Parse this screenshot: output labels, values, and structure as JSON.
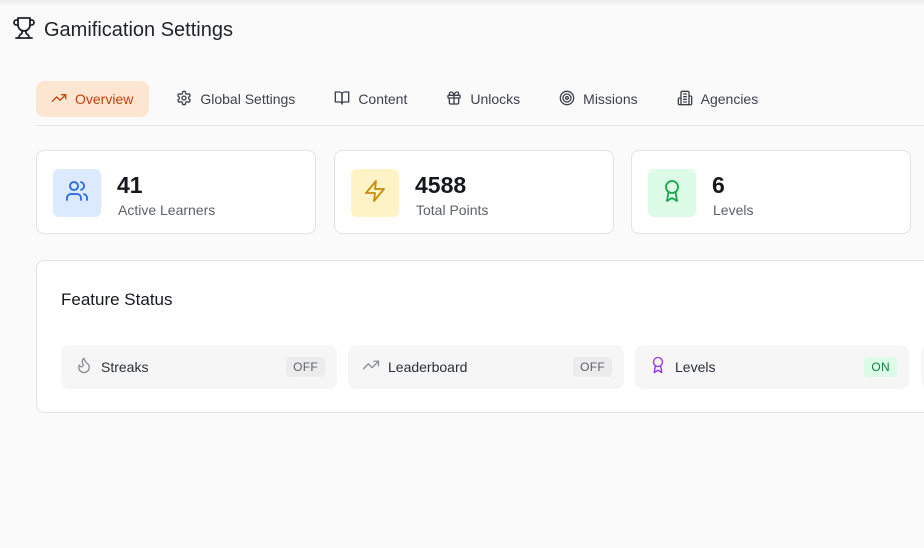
{
  "header": {
    "title": "Gamification Settings",
    "icon": "trophy-icon"
  },
  "tabs": [
    {
      "label": "Overview",
      "icon": "trending-up-icon",
      "active": true
    },
    {
      "label": "Global Settings",
      "icon": "gear-icon",
      "active": false
    },
    {
      "label": "Content",
      "icon": "book-icon",
      "active": false
    },
    {
      "label": "Unlocks",
      "icon": "gift-icon",
      "active": false
    },
    {
      "label": "Missions",
      "icon": "target-icon",
      "active": false
    },
    {
      "label": "Agencies",
      "icon": "building-icon",
      "active": false
    }
  ],
  "stats": [
    {
      "value": "41",
      "label": "Active Learners",
      "icon": "users-icon",
      "color": "#2563eb",
      "bg": "#dbeafe"
    },
    {
      "value": "4588",
      "label": "Total Points",
      "icon": "lightning-icon",
      "color": "#ca8a04",
      "bg": "#fef3c7"
    },
    {
      "value": "6",
      "label": "Levels",
      "icon": "award-icon",
      "color": "#16a34a",
      "bg": "#dcfce7"
    }
  ],
  "feature_status": {
    "title": "Feature Status",
    "items": [
      {
        "label": "Streaks",
        "status": "OFF",
        "icon": "flame-icon",
        "color": "#8a8f98"
      },
      {
        "label": "Leaderboard",
        "status": "OFF",
        "icon": "trending-up-icon",
        "color": "#8a8f98"
      },
      {
        "label": "Levels",
        "status": "ON",
        "icon": "award-icon",
        "color": "#9333ea"
      }
    ]
  },
  "colors": {
    "accent": "#c2410c",
    "accent_bg": "#fde6d1",
    "on": "#15803d",
    "on_bg": "#dcfce7"
  }
}
